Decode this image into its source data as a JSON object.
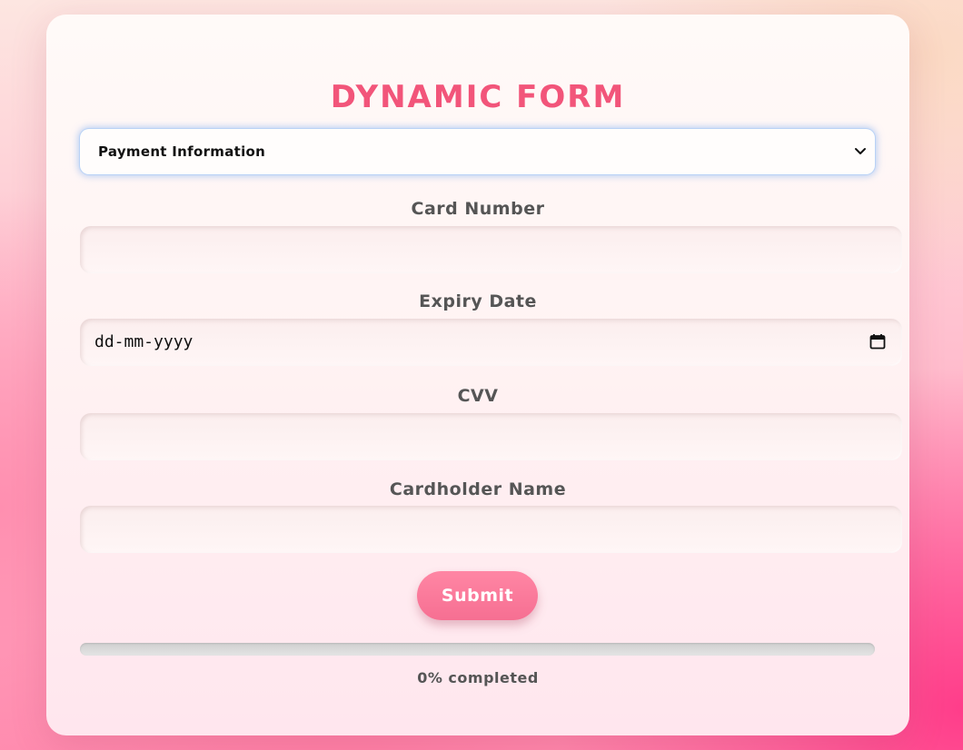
{
  "form": {
    "title": "DYNAMIC FORM",
    "section_select": {
      "selected": "Payment Information"
    },
    "fields": [
      {
        "label": "Card Number",
        "value": ""
      },
      {
        "label": "Expiry Date",
        "value": "dd-mm-yyyy"
      },
      {
        "label": "CVV",
        "value": ""
      },
      {
        "label": "Cardholder Name",
        "value": ""
      }
    ],
    "submit_label": "Submit",
    "progress": {
      "percent": 0,
      "text": "0% completed"
    }
  },
  "colors": {
    "accent": "#f2557a",
    "button": "#f66f92",
    "label": "#555555"
  },
  "icons": {
    "select_arrow": "chevron-down-icon",
    "date_picker": "calendar-icon"
  }
}
